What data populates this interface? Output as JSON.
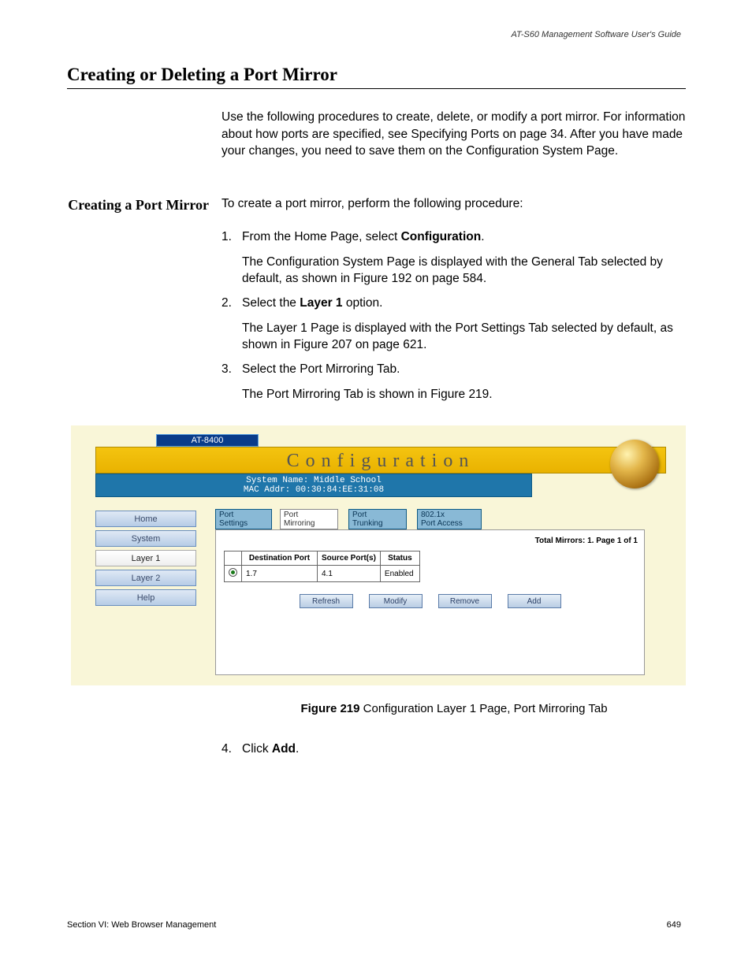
{
  "meta": {
    "guide_title": "AT-S60 Management Software User's Guide",
    "section_footer": "Section VI: Web Browser Management",
    "page_number": "649"
  },
  "headings": {
    "section": "Creating or Deleting a Port Mirror",
    "subsection": "Creating a Port Mirror"
  },
  "paragraphs": {
    "intro": "Use the following procedures to create, delete, or modify a port mirror. For information about how ports are specified, see Specifying Ports on page 34. After you have made your changes, you need to save them on the Configuration System Page.",
    "proc_intro": "To create a port mirror, perform the following procedure:"
  },
  "steps": {
    "s1_num": "1.",
    "s1_a": "From the Home Page, select ",
    "s1_b": "Configuration",
    "s1_c": ".",
    "s1_follow": "The Configuration System Page is displayed with the General Tab selected by default, as shown in Figure 192 on page 584.",
    "s2_num": "2.",
    "s2_a": "Select the ",
    "s2_b": "Layer 1",
    "s2_c": " option.",
    "s2_follow": "The Layer 1 Page is displayed with the Port Settings Tab selected by default, as shown in Figure 207 on page 621.",
    "s3_num": "3.",
    "s3_text": "Select the Port Mirroring Tab.",
    "s3_follow": "The Port Mirroring Tab is shown in Figure 219.",
    "s4_num": "4.",
    "s4_a": "Click ",
    "s4_b": "Add",
    "s4_c": "."
  },
  "figure": {
    "caption_bold": "Figure 219",
    "caption_rest": "  Configuration Layer 1 Page, Port Mirroring Tab",
    "device": "AT-8400",
    "title": "Configuration",
    "sysname": "System Name: Middle School",
    "mac": "MAC Addr: 00:30:84:EE:31:08",
    "nav": {
      "home": "Home",
      "system": "System",
      "layer1": "Layer 1",
      "layer2": "Layer 2",
      "help": "Help"
    },
    "tabs": {
      "port_settings": "Port\nSettings",
      "port_mirroring": "Port\nMirroring",
      "port_trunking": "Port\nTrunking",
      "dot1x": "802.1x\nPort Access"
    },
    "panel": {
      "totals": "Total Mirrors: 1. Page 1 of 1",
      "th_dest": "Destination Port",
      "th_src": "Source Port(s)",
      "th_status": "Status",
      "row_dest": "1.7",
      "row_src": "4.1",
      "row_status": "Enabled",
      "btn_refresh": "Refresh",
      "btn_modify": "Modify",
      "btn_remove": "Remove",
      "btn_add": "Add"
    }
  }
}
